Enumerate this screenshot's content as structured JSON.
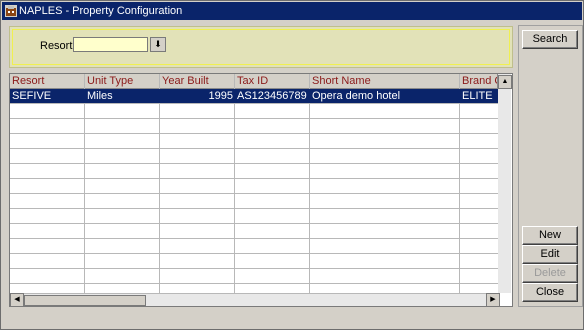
{
  "window": {
    "title": "NAPLES - Property Configuration"
  },
  "search": {
    "resort_label": "Resort",
    "resort_value": "",
    "dropdown_glyph": "⬇"
  },
  "grid": {
    "columns": [
      "Resort",
      "Unit Type",
      "Year Built",
      "Tax ID",
      "Short Name",
      "Brand Co"
    ],
    "rows": [
      {
        "resort": "SEFIVE",
        "unit_type": "Miles",
        "year_built": "1995",
        "tax_id": "AS123456789",
        "short_name": "Opera demo hotel",
        "brand": "ELITE"
      }
    ]
  },
  "buttons": {
    "search": "Search",
    "new": "New",
    "edit": "Edit",
    "delete": "Delete",
    "close": "Close"
  },
  "colors": {
    "titlebar": "#0a246a",
    "selected_row": "#0a246a",
    "header_text": "#8b1a1a",
    "input_bg": "#ffffcc",
    "search_panel": "#e2e2b8"
  }
}
